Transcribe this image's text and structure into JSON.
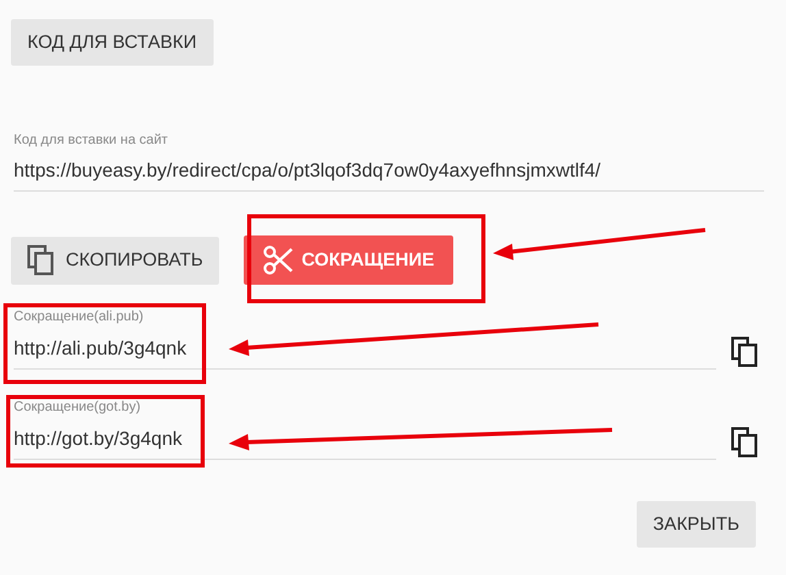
{
  "embed_button": "КОД ДЛЯ ВСТАВКИ",
  "embed_field": {
    "label": "Код для вставки на сайт",
    "value": "https://buyeasy.by/redirect/cpa/o/pt3lqof3dq7ow0y4axyefhnsjmxwtlf4/"
  },
  "copy_button": "СКОПИРОВАТЬ",
  "shorten_button": "СОКРАЩЕНИЕ",
  "short_links": [
    {
      "label": "Сокращение(ali.pub)",
      "value": "http://ali.pub/3g4qnk"
    },
    {
      "label": "Сокращение(got.by)",
      "value": "http://got.by/3g4qnk"
    }
  ],
  "close_button": "ЗАКРЫТЬ"
}
